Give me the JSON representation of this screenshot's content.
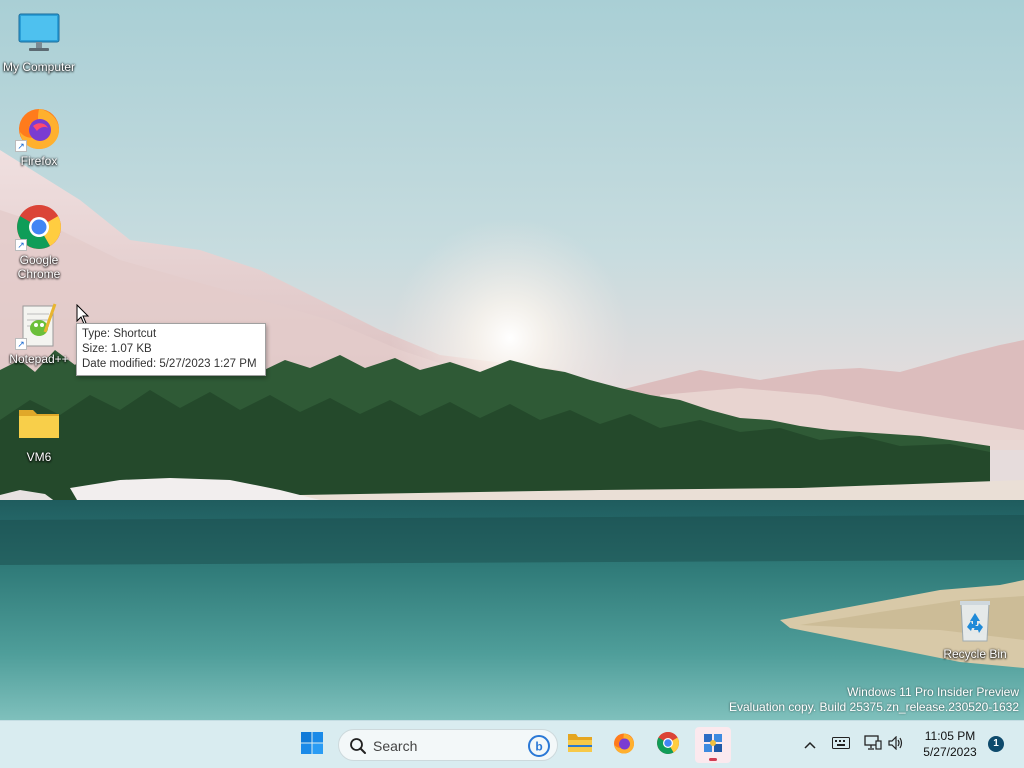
{
  "desktop": {
    "icons": [
      {
        "label": "My Computer",
        "icon": "monitor-icon"
      },
      {
        "label": "Firefox",
        "icon": "firefox-icon",
        "shortcut": true
      },
      {
        "label": "Google Chrome",
        "icon": "chrome-icon",
        "shortcut": true
      },
      {
        "label": "Notepad++",
        "icon": "notepadpp-icon",
        "shortcut": true
      },
      {
        "label": "VM6",
        "icon": "folder-icon"
      },
      {
        "label": "Recycle Bin",
        "icon": "recycle-bin-icon"
      }
    ]
  },
  "tooltip": {
    "type": "Type: Shortcut",
    "size": "Size: 1.07 KB",
    "date_modified": "Date modified: 5/27/2023 1:27 PM"
  },
  "watermark": {
    "line1": "Windows 11 Pro Insider Preview",
    "line2": "Evaluation copy. Build 25375.zn_release.230520-1632"
  },
  "taskbar": {
    "search_placeholder": "Search",
    "apps": [
      {
        "name": "start",
        "icon": "windows-logo-icon"
      },
      {
        "name": "file-explorer",
        "icon": "folder-icon"
      },
      {
        "name": "firefox",
        "icon": "firefox-icon"
      },
      {
        "name": "chrome",
        "icon": "chrome-icon"
      },
      {
        "name": "app",
        "icon": "puzzle-app-icon",
        "active": true
      }
    ],
    "clock": {
      "time": "11:05 PM",
      "date": "5/27/2023"
    },
    "notification_count": "1"
  },
  "colors": {
    "taskbar_bg": "#d9ecf0",
    "accent": "#0067c0",
    "badge": "#0e4a6c"
  }
}
